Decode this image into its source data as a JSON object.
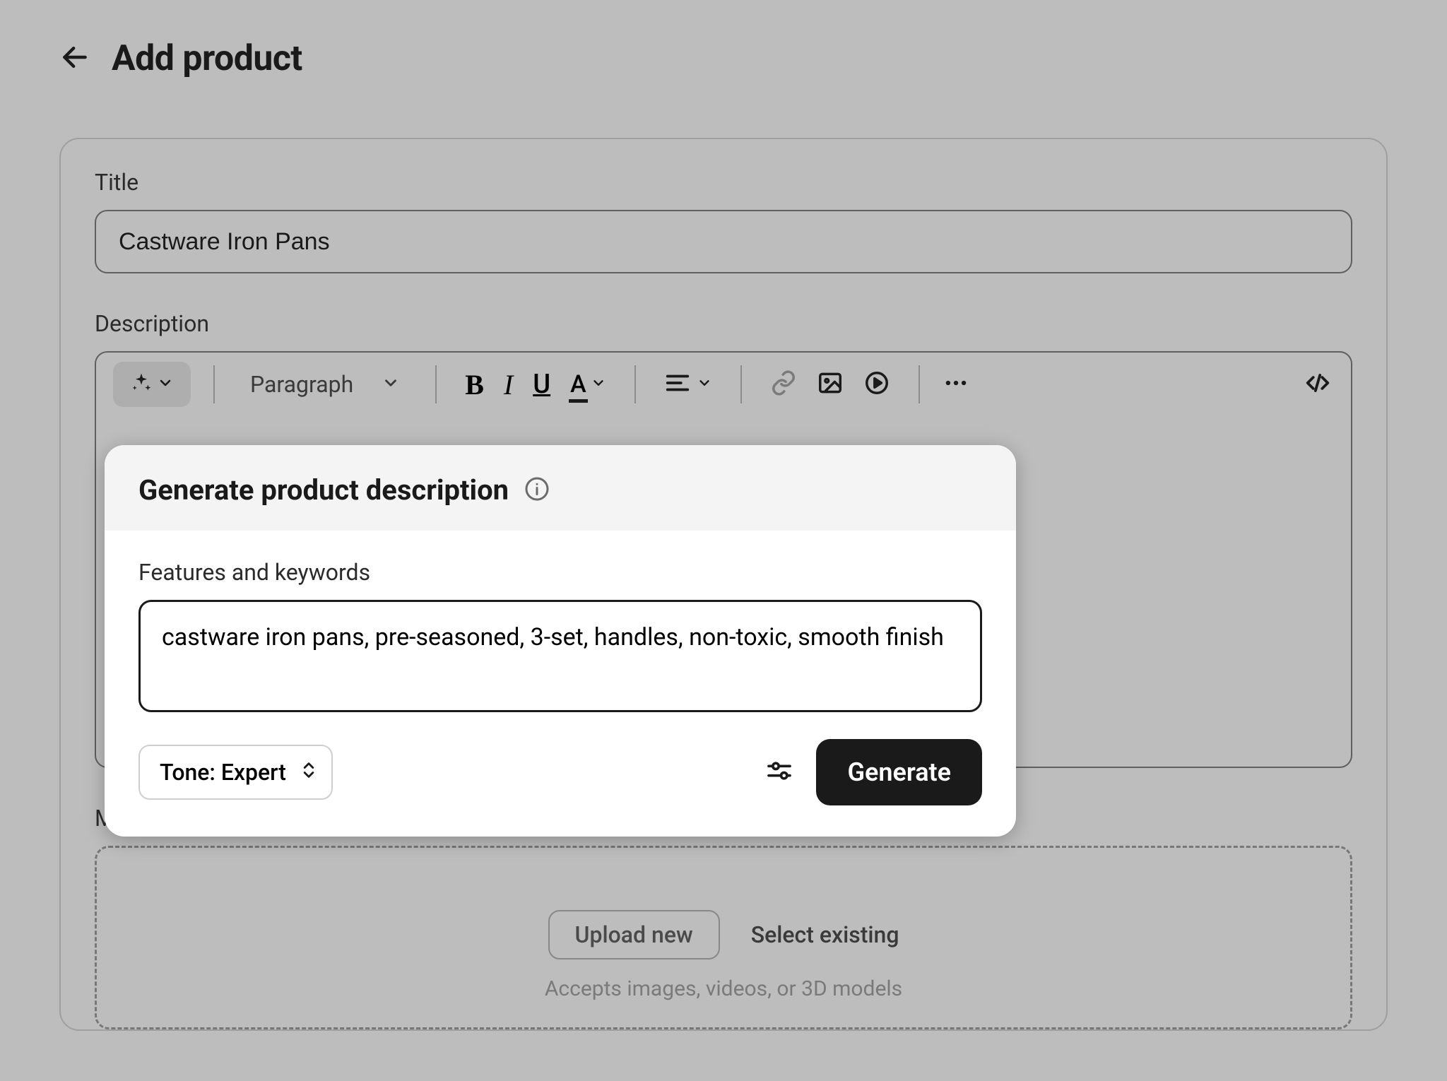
{
  "header": {
    "title": "Add product"
  },
  "fields": {
    "title_label": "Title",
    "title_value": "Castware Iron Pans",
    "description_label": "Description",
    "media_label": "Media"
  },
  "toolbar": {
    "format_label": "Paragraph"
  },
  "popover": {
    "title": "Generate product description",
    "keywords_label": "Features and keywords",
    "keywords_value": "castware iron pans, pre-seasoned, 3-set, handles, non-toxic, smooth finish",
    "tone_label": "Tone: Expert",
    "generate_label": "Generate"
  },
  "media": {
    "upload_label": "Upload new",
    "select_label": "Select existing",
    "hint": "Accepts images, videos, or 3D models"
  }
}
